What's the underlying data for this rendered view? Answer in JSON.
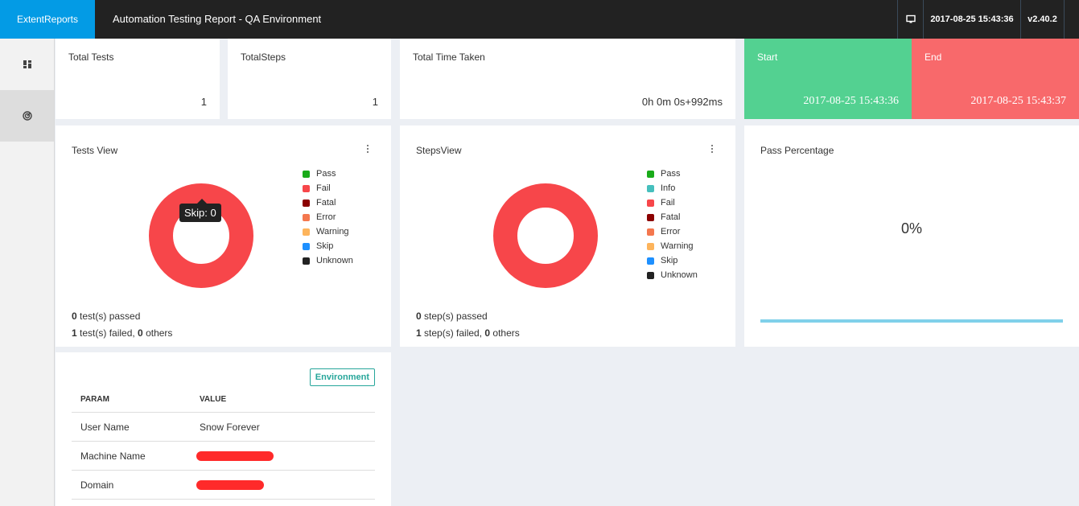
{
  "header": {
    "brand": "ExtentReports",
    "title": "Automation Testing Report - QA Environment",
    "datetime": "2017-08-25 15:43:36",
    "version": "v2.40.2",
    "monitor_icon": "monitor-icon"
  },
  "sidebar": {
    "items": [
      {
        "icon": "dashboard-icon"
      },
      {
        "icon": "analysis-icon"
      }
    ]
  },
  "stats": {
    "total_tests": {
      "label": "Total Tests",
      "value": "1"
    },
    "total_steps": {
      "label": "TotalSteps",
      "value": "1"
    },
    "total_time": {
      "label": "Total Time Taken",
      "value": "0h 0m 0s+992ms"
    },
    "start": {
      "label": "Start",
      "value": "2017-08-25 15:43:36"
    },
    "end": {
      "label": "End",
      "value": "2017-08-25 15:43:37"
    }
  },
  "tests_view": {
    "title": "Tests View",
    "tooltip": "Skip: 0",
    "legend": [
      {
        "label": "Pass",
        "color": "#1aab1a"
      },
      {
        "label": "Fail",
        "color": "#f7464a"
      },
      {
        "label": "Fatal",
        "color": "#8b0000"
      },
      {
        "label": "Error",
        "color": "#f4774e"
      },
      {
        "label": "Warning",
        "color": "#fdb45c"
      },
      {
        "label": "Skip",
        "color": "#1e90ff"
      },
      {
        "label": "Unknown",
        "color": "#222222"
      }
    ],
    "passed_count": "0",
    "passed_text": " test(s) passed",
    "failed_count": "1",
    "failed_text": " test(s) failed, ",
    "others_count": "0",
    "others_text": " others"
  },
  "steps_view": {
    "title": "StepsView",
    "legend": [
      {
        "label": "Pass",
        "color": "#1aab1a"
      },
      {
        "label": "Info",
        "color": "#46bfbd"
      },
      {
        "label": "Fail",
        "color": "#f7464a"
      },
      {
        "label": "Fatal",
        "color": "#8b0000"
      },
      {
        "label": "Error",
        "color": "#f4774e"
      },
      {
        "label": "Warning",
        "color": "#fdb45c"
      },
      {
        "label": "Skip",
        "color": "#1e90ff"
      },
      {
        "label": "Unknown",
        "color": "#222222"
      }
    ],
    "passed_count": "0",
    "passed_text": " step(s) passed",
    "failed_count": "1",
    "failed_text": " step(s) failed, ",
    "others_count": "0",
    "others_text": " others"
  },
  "pass_percentage": {
    "title": "Pass Percentage",
    "value": "0%",
    "fraction": 0
  },
  "environment": {
    "badge": "Environment",
    "headers": {
      "param": "PARAM",
      "value": "VALUE"
    },
    "rows": [
      {
        "param": "User Name",
        "value": "Snow Forever"
      },
      {
        "param": "Machine Name",
        "value": ""
      },
      {
        "param": "Domain",
        "value": ""
      }
    ]
  },
  "colors": {
    "brand": "#039be5",
    "start": "#53d191",
    "end": "#f8696b",
    "fail": "#f7464a",
    "environment": "#26a69a"
  }
}
